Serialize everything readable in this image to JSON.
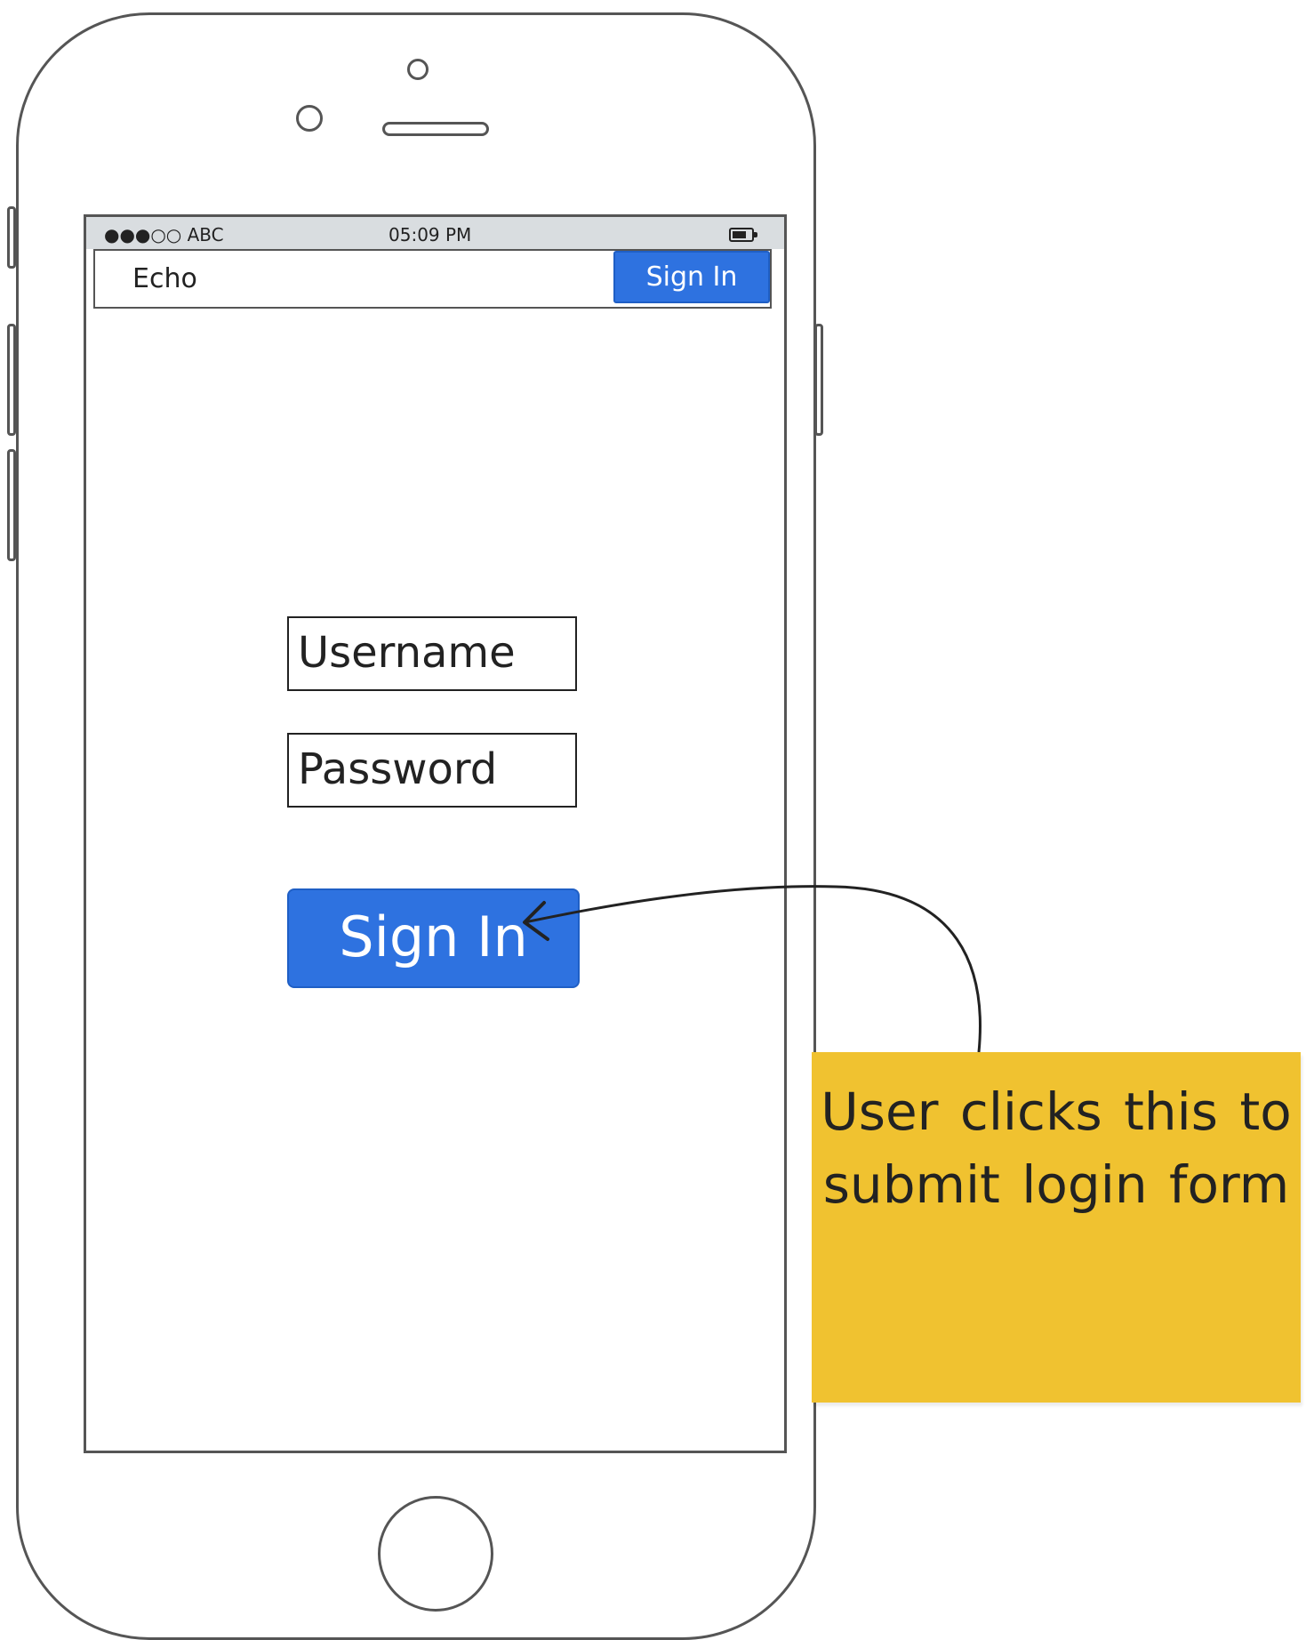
{
  "status_bar": {
    "carrier": "●●●○○ ABC",
    "time": "05:09 PM",
    "battery_icon": "battery-icon"
  },
  "navbar": {
    "title": "Echo",
    "signin_label": "Sign In"
  },
  "form": {
    "username_placeholder": "Username",
    "password_placeholder": "Password",
    "signin_label": "Sign In"
  },
  "annotation": {
    "note_text": "User clicks this to submit login form",
    "note_color": "#f0c230"
  },
  "colors": {
    "accent": "#2e72e0",
    "outline": "#555555"
  }
}
